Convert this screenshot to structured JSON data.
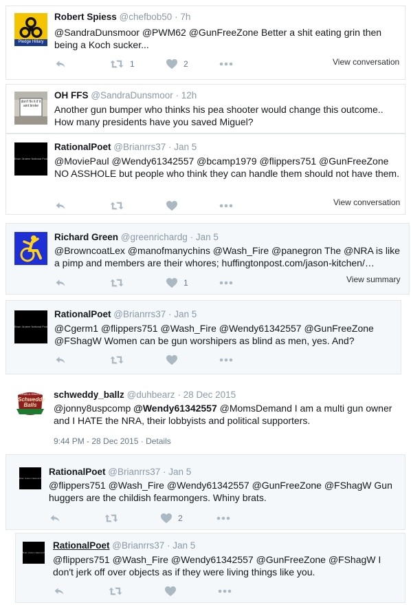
{
  "tweets": [
    {
      "name": "Robert Spiess",
      "handle": "@chefbob50",
      "time": "· 7h",
      "text": "@SandraDunsmoor @PWM62 @GunFreeZone Better a shit eating grin then being a Koch sucker...",
      "avatar_caption": "Pledge Hillary",
      "retweets": "1",
      "likes": "2",
      "link": "View conversation"
    },
    {
      "name": "OH FFS",
      "handle": "@SandraDunsmoor",
      "time": "· 12h",
      "text": "Another gun bumper who thinks his pea shooter would change this outcome.. How many presidents have you saved Miguel?"
    },
    {
      "name": "RationalPoet",
      "handle": "@Brianrrs37",
      "time": "· Jan 5",
      "text": "@MoviePaul @Wendy61342557 @bcamp1979  @flippers751 @GunFreeZone NO ASSHOLE but people who think they can handle them should not have them.",
      "link": "View conversation"
    },
    {
      "name": "Richard Green",
      "handle": "@greenrichardg",
      "time": "· Jan 5",
      "text": "@BrowncoatLex @manofmanychins @Wash_Fire @panegron The @NRA is like a pimp and members are their whores; huffingtonpost.com/jason-kitchen/…",
      "likes": "1",
      "link": "View summary"
    },
    {
      "name": "RationalPoet",
      "handle": "@Brianrrs37",
      "time": "· Jan 5",
      "text": "@Cgerm1 @flippers751 @Wash_Fire @Wendy61342557 @GunFreeZone @FShagW Women can be gun worshipers as blind as men, yes. And?"
    },
    {
      "name": "schweddy_ballz",
      "handle": "@duhbearz",
      "time": "· 28 Dec 2015",
      "text_pre": "@jonny8uspcomp ",
      "text_bold": "@Wendy61342557",
      "text_post": " @MomsDemand I am a multi gun owner and I HATE the NRA, their lobbyists and political supporters.",
      "timestamp": "9:44 PM - 28 Dec 2015",
      "details": "· Details"
    },
    {
      "name": "RationalPoet",
      "handle": "@Brianrrs37",
      "time": "· Jan 5",
      "text": "@flippers751 @Wash_Fire @Wendy61342557 @GunFreeZone @FShagW Gun huggers are the childish fearmongers. Whiny brats.",
      "likes": "2"
    },
    {
      "name": "RationalPoet",
      "handle": "@Brianrrs37",
      "time": "· Jan 5",
      "text": "@flippers751 @Wash_Fire @Wendy61342557 @GunFreeZone @FShagW I don't jerk off over objects as if they were living things like you."
    }
  ],
  "avatar_texts": {
    "sign": "don't fix it if it aint broke",
    "schweddy_top": "GRAB-A-SNACK",
    "schweddy_main": "Schweddy Balls",
    "rp_caption": "Brian Jindem National Post"
  },
  "colors": {
    "link": "#1da1f2",
    "muted": "#8899a6",
    "icon": "#aab8c2",
    "shade": "#f5f8fa"
  }
}
